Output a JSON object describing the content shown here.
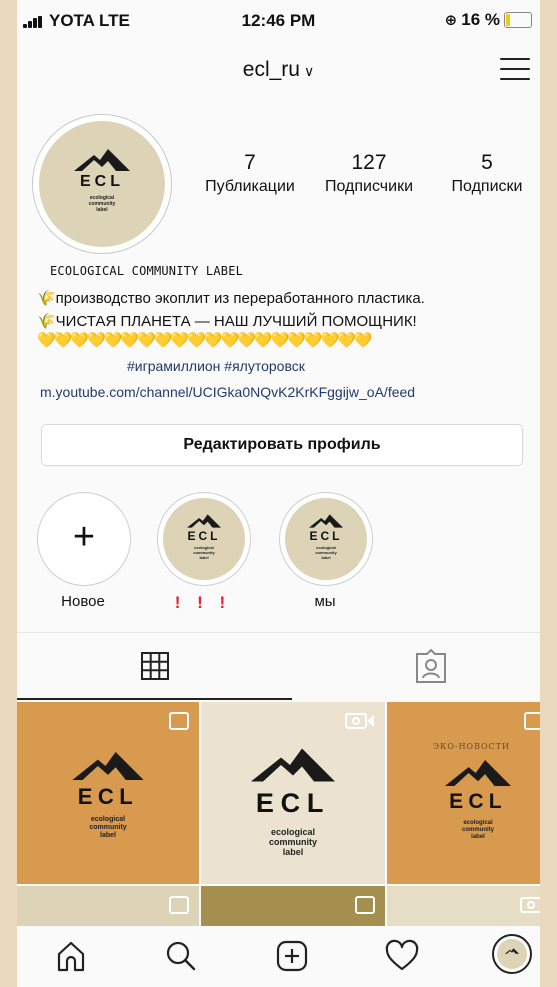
{
  "status": {
    "carrier": "YOTA LTE",
    "time": "12:46 PM",
    "battery_text": "16 %",
    "battery_level": 0.16
  },
  "header": {
    "username": "ecl_ru",
    "chevron": "∨"
  },
  "profile": {
    "avatar_logo": {
      "letters": "ECL",
      "sub": [
        "ecological",
        "community",
        "label"
      ]
    },
    "stats": [
      {
        "value": "7",
        "label": "Публикации"
      },
      {
        "value": "127",
        "label": "Подписчики"
      },
      {
        "value": "5",
        "label": "Подписки"
      }
    ],
    "bio_name": "ECOLOGICAL COMMUNITY LABEL",
    "bio_lines": [
      "🌾производство экоплит из переработанного пластика.",
      "🌾ЧИСТАЯ ПЛАНЕТА — НАШ ЛУЧШИЙ ПОМОЩНИК!"
    ],
    "hearts": "💛💛💛💛💛💛💛💛💛💛💛💛💛💛💛💛💛💛💛💛",
    "hashtags": "#игрaмиллион #ялуторовск",
    "link": "m.youtube.com/channel/UCIGka0NQvK2KrKFggijw_oA/feed",
    "edit_button": "Редактировать профиль"
  },
  "highlights": [
    {
      "label": "Новое",
      "type": "new"
    },
    {
      "label": "! ! !",
      "type": "story"
    },
    {
      "label": "мы",
      "type": "story"
    }
  ],
  "tabs": [
    {
      "name": "grid-icon",
      "active": true
    },
    {
      "name": "tagged-icon",
      "active": false
    }
  ],
  "grid_posts": [
    {
      "bg": "#d79a4f",
      "badge": "carousel-icon",
      "caption": ""
    },
    {
      "bg": "#ebe2cf",
      "badge": "video-icon",
      "caption": ""
    },
    {
      "bg": "#d79a4f",
      "badge": "carousel-icon",
      "caption": "ЭКО-НОВОСТИ"
    }
  ],
  "nav": [
    "home-icon",
    "search-icon",
    "new-post-icon",
    "heart-icon",
    "profile-avatar"
  ],
  "colors": {
    "accent_red": "#e0242a",
    "link": "#233a6b",
    "post_orange": "#d79a4f",
    "post_cream": "#ebe2cf",
    "olive": "#a58f4f"
  }
}
